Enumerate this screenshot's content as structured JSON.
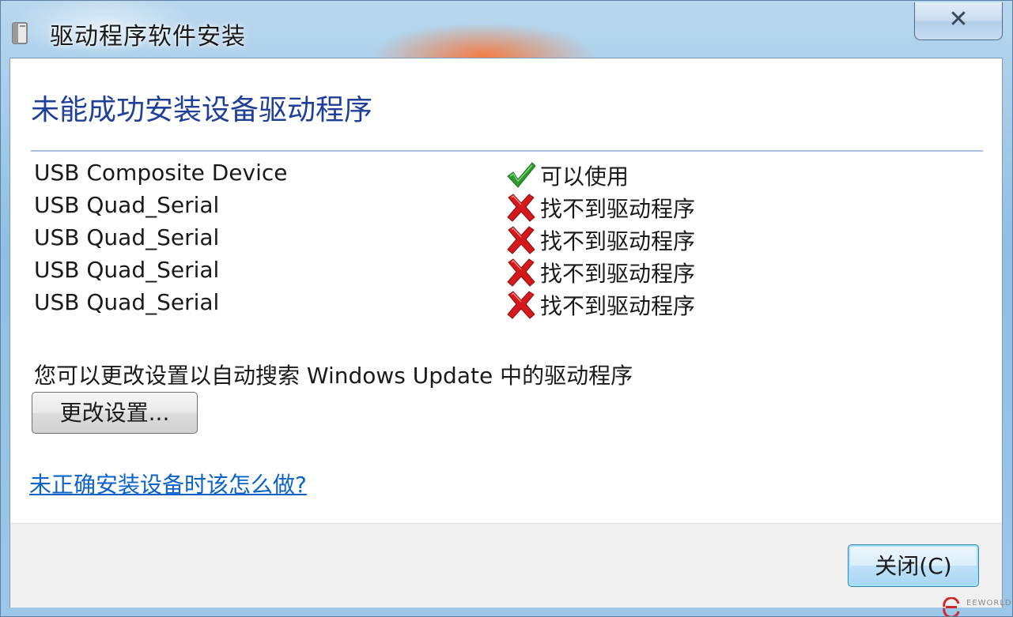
{
  "window": {
    "title": "驱动程序软件安装",
    "close_glyph": "✕"
  },
  "main": {
    "heading": "未能成功安装设备驱动程序",
    "devices": [
      {
        "name": "USB Composite Device",
        "status": "可以使用",
        "status_icon": "checkmark-icon"
      },
      {
        "name": "USB Quad_Serial",
        "status": "找不到驱动程序",
        "status_icon": "error-x-icon"
      },
      {
        "name": "USB Quad_Serial",
        "status": "找不到驱动程序",
        "status_icon": "error-x-icon"
      },
      {
        "name": "USB Quad_Serial",
        "status": "找不到驱动程序",
        "status_icon": "error-x-icon"
      },
      {
        "name": "USB Quad_Serial",
        "status": "找不到驱动程序",
        "status_icon": "error-x-icon"
      }
    ],
    "hint": "您可以更改设置以自动搜索 Windows Update 中的驱动程序",
    "change_settings_label": "更改设置...",
    "help_link": "未正确安装设备时该怎么做?"
  },
  "footer": {
    "close_label": "关闭(C)"
  },
  "watermark": {
    "text": "EEWORLD"
  },
  "colors": {
    "heading": "#1f3f99",
    "link": "#0b63c9",
    "success": "#2e9b2e",
    "error": "#d3191b"
  }
}
